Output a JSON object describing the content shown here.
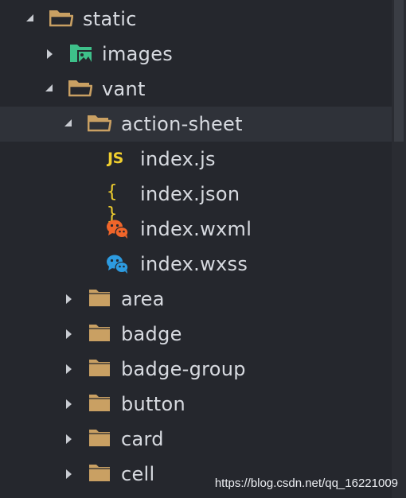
{
  "tree": {
    "root": {
      "label": "static",
      "state": "expanded",
      "icon": "folder-open-icon"
    },
    "images": {
      "label": "images",
      "state": "collapsed",
      "icon": "image-folder-icon"
    },
    "vant": {
      "label": "vant",
      "state": "expanded",
      "icon": "folder-open-icon"
    },
    "action_sheet": {
      "label": "action-sheet",
      "state": "expanded",
      "selected": true,
      "icon": "folder-open-icon",
      "files": [
        {
          "label": "index.js",
          "icon": "js-file-icon",
          "glyph": "JS"
        },
        {
          "label": "index.json",
          "icon": "json-file-icon",
          "glyph": "{ }"
        },
        {
          "label": "index.wxml",
          "icon": "wechat-orange-icon"
        },
        {
          "label": "index.wxss",
          "icon": "wechat-blue-icon"
        }
      ]
    },
    "folders": [
      {
        "label": "area",
        "state": "collapsed",
        "icon": "folder-icon"
      },
      {
        "label": "badge",
        "state": "collapsed",
        "icon": "folder-icon"
      },
      {
        "label": "badge-group",
        "state": "collapsed",
        "icon": "folder-icon"
      },
      {
        "label": "button",
        "state": "collapsed",
        "icon": "folder-icon"
      },
      {
        "label": "card",
        "state": "collapsed",
        "icon": "folder-icon"
      },
      {
        "label": "cell",
        "state": "collapsed",
        "icon": "folder-icon"
      }
    ]
  },
  "colors": {
    "background": "#25272d",
    "selected_row": "#2f3239",
    "text": "#d7dae0",
    "folder": "#c9a063",
    "js": "#f1cf2e",
    "wechat_orange": "#f0652a",
    "wechat_blue": "#2d9be0",
    "images_green": "#3ec08a"
  },
  "watermark": "https://blog.csdn.net/qq_16221009"
}
